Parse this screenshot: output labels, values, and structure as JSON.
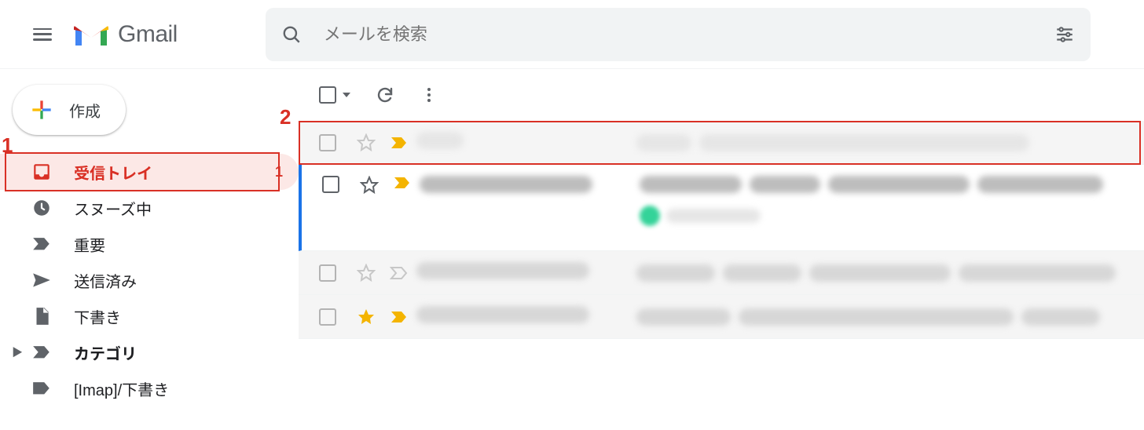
{
  "header": {
    "product_name": "Gmail",
    "search_placeholder": "メールを検索"
  },
  "compose": {
    "label": "作成"
  },
  "sidebar": {
    "items": [
      {
        "label": "受信トレイ",
        "icon": "inbox",
        "active": true,
        "count": "1"
      },
      {
        "label": "スヌーズ中",
        "icon": "clock",
        "active": false
      },
      {
        "label": "重要",
        "icon": "important",
        "active": false
      },
      {
        "label": "送信済み",
        "icon": "sent",
        "active": false
      },
      {
        "label": "下書き",
        "icon": "draft",
        "active": false
      },
      {
        "label": "カテゴリ",
        "icon": "folder",
        "active": false,
        "bold": true,
        "has_children": true
      },
      {
        "label": "[Imap]/下書き",
        "icon": "label",
        "active": false
      }
    ]
  },
  "annotations": {
    "callout_1": "1",
    "callout_2": "2"
  }
}
